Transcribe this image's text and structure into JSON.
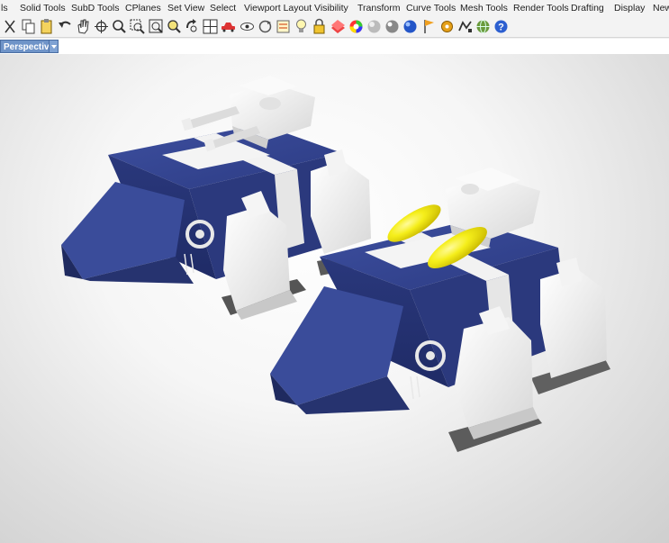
{
  "menu_tabs": [
    "ls",
    "Solid Tools",
    "SubD Tools",
    "CPlanes",
    "Set View",
    "Select",
    "Viewport Layout",
    "Visibility",
    "Transform",
    "Curve Tools",
    "Mesh Tools",
    "Render Tools",
    "Drafting",
    "Display",
    "New"
  ],
  "toolbar_tools": [
    "cut-icon",
    "copy-icon",
    "paste-icon",
    "undo-icon",
    "pan-hand-icon",
    "rotate-view-icon",
    "zoom-icon",
    "zoom-window-icon",
    "zoom-extents-icon",
    "zoom-selected-icon",
    "undo-view-icon",
    "four-viewports-icon",
    "car-icon",
    "eye-icon",
    "circle-arrow-icon",
    "properties-icon",
    "light-bulb-icon",
    "padlock-icon",
    "layer-paint-icon",
    "color-wheel-icon",
    "sphere-gray-icon",
    "render-sphere-icon",
    "blue-sphere-icon",
    "flag-icon",
    "gear-icon",
    "grasshopper-icon",
    "globe-icon",
    "help-icon"
  ],
  "viewport": {
    "label": "Perspective"
  },
  "colors": {
    "hull_blue": "#2f3f88",
    "armor_white": "#ececec",
    "tread_gray": "#6b6b6b",
    "thruster_yellow": "#f4ea12"
  }
}
